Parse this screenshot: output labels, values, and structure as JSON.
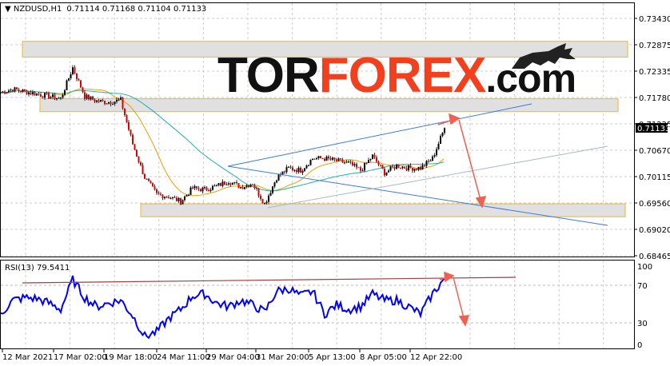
{
  "header": {
    "symbol": "NZDUSD,H1",
    "ohlc": "0.71114 0.71168 0.71104 0.71133"
  },
  "logo": {
    "part1": "TOR",
    "part2": "FOREX",
    "part3": ".com"
  },
  "indicator": {
    "label": "RSI(13) 79.5411"
  },
  "current_price_label": "0.71133",
  "colors": {
    "up": "#00a000",
    "down": "#e00000",
    "bar": "#000000",
    "rsi": "#0000ff",
    "ma_fast": "#e8a000",
    "ma_slow": "#20b0b0",
    "zone_border": "#f0c040",
    "zone_fill": "#e0e0e0",
    "channel": "#3a7be0",
    "arrow": "#f06050"
  },
  "chart_data": [
    {
      "type": "line",
      "title": "NZDUSD,H1",
      "ylim": [
        0.68465,
        0.7343
      ],
      "y_ticks": [
        "0.73430",
        "0.72875",
        "0.72335",
        "0.71780",
        "0.71225",
        "0.70670",
        "0.70115",
        "0.69560",
        "0.69020",
        "0.68465"
      ],
      "x_ticks": [
        "12 Mar 2021",
        "17 Mar 02:00",
        "19 Mar 18:00",
        "24 Mar 11:00",
        "29 Mar 04:00",
        "31 Mar 20:00",
        "5 Apr 13:00",
        "8 Apr 05:00",
        "12 Apr 22:00"
      ],
      "series": [
        {
          "name": "NZDUSD close",
          "values": [
            0.7188,
            0.7195,
            0.719,
            0.7185,
            0.718,
            0.7175,
            0.724,
            0.718,
            0.717,
            0.7168,
            0.7172,
            0.708,
            0.701,
            0.6975,
            0.697,
            0.696,
            0.6988,
            0.6985,
            0.6992,
            0.7003,
            0.699,
            0.6998,
            0.6955,
            0.701,
            0.703,
            0.7025,
            0.705,
            0.705,
            0.7045,
            0.704,
            0.7025,
            0.7055,
            0.702,
            0.7035,
            0.703,
            0.703,
            0.705,
            0.71133
          ]
        }
      ],
      "zones": [
        [
          0.7262,
          0.7295
        ],
        [
          0.7148,
          0.7175
        ],
        [
          0.6928,
          0.6955
        ]
      ]
    },
    {
      "type": "line",
      "title": "RSI(13)",
      "ylim": [
        0,
        100
      ],
      "y_ticks": [
        "100",
        "70",
        "30",
        "0"
      ],
      "series": [
        {
          "name": "RSI(13)",
          "values": [
            40,
            55,
            58,
            57,
            52,
            45,
            78,
            58,
            48,
            52,
            55,
            38,
            15,
            20,
            35,
            45,
            60,
            62,
            52,
            48,
            55,
            50,
            42,
            65,
            68,
            60,
            65,
            40,
            50,
            45,
            48,
            62,
            55,
            55,
            48,
            40,
            62,
            79.5
          ]
        }
      ]
    }
  ]
}
